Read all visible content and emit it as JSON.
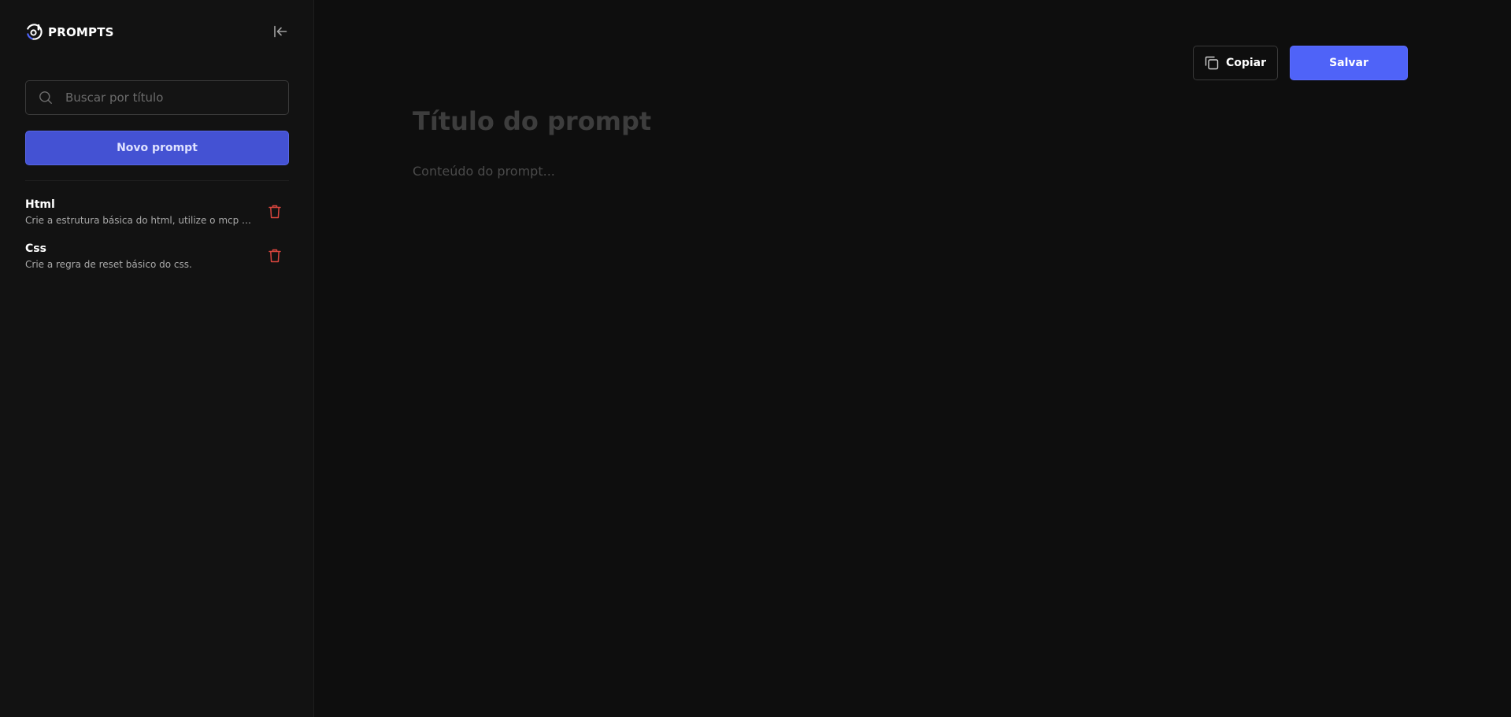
{
  "app": {
    "brand_name": "PROMPTS",
    "accent_color": "#4f63f8",
    "logo_icon": "brand-logo-icon"
  },
  "sidebar": {
    "collapse_icon": "collapse-left-icon",
    "search": {
      "placeholder": "Buscar por título",
      "value": "",
      "icon": "search-icon"
    },
    "new_prompt_label": "Novo prompt",
    "items": [
      {
        "title": "Html",
        "description": "Crie a estrutura básica do html, utilize o mcp con...",
        "action_icon": "trash-icon"
      },
      {
        "title": "Css",
        "description": "Crie a regra de reset básico do css.",
        "action_icon": "trash-icon"
      }
    ]
  },
  "editor": {
    "copy_label": "Copiar",
    "copy_icon": "copy-icon",
    "save_label": "Salvar",
    "title_placeholder": "Título do prompt",
    "title_value": "",
    "content_placeholder": "Conteúdo do prompt...",
    "content_value": ""
  }
}
